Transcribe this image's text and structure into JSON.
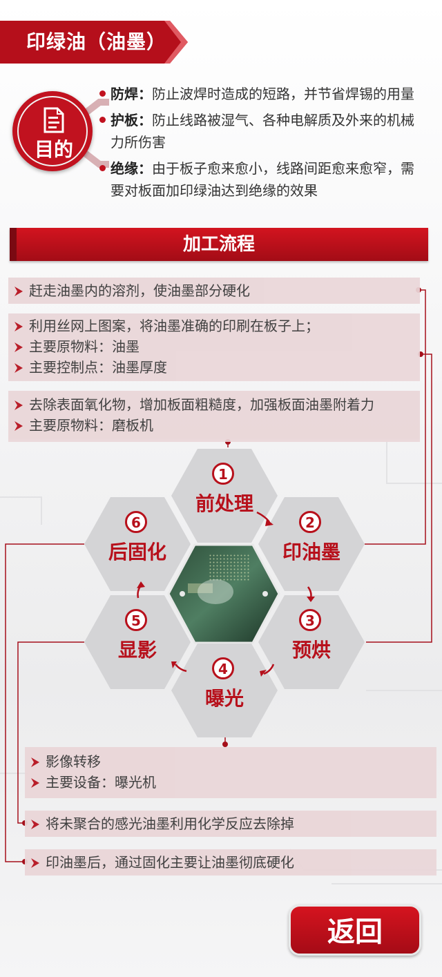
{
  "header": {
    "title": "印绿油（油墨）"
  },
  "purpose": {
    "badge_label": "目的",
    "items": [
      {
        "term": "防焊：",
        "text": "防止波焊时造成的短路，并节省焊锡的用量"
      },
      {
        "term": "护板：",
        "text": "防止线路被湿气、各种电解质及外来的机械力所伤害"
      },
      {
        "term": "绝缘：",
        "text": "由于板子愈来愈小，线路间距愈来愈窄，需要对板面加印绿油达到绝缘的效果"
      }
    ]
  },
  "process": {
    "section_title": "加工流程",
    "boxes": {
      "cure": [
        "赶走油墨内的溶剂，使油墨部分硬化"
      ],
      "print": [
        "利用丝网上图案，将油墨准确的印刷在板子上；",
        "主要原物料：油墨",
        "主要控制点：油墨厚度"
      ],
      "pretreat": [
        "去除表面氧化物，增加板面粗糙度，加强板面油墨附着力",
        "主要原物料：磨板机"
      ],
      "expose": [
        "影像转移",
        "主要设备：曝光机"
      ],
      "develop": [
        "将未聚合的感光油墨利用化学反应去除掉"
      ],
      "postcure": [
        "印油墨后，通过固化主要让油墨彻底硬化"
      ]
    },
    "steps": [
      {
        "num": "1",
        "label": "前处理"
      },
      {
        "num": "2",
        "label": "印油墨"
      },
      {
        "num": "3",
        "label": "预烘"
      },
      {
        "num": "4",
        "label": "曝光"
      },
      {
        "num": "5",
        "label": "显影"
      },
      {
        "num": "6",
        "label": "后固化"
      }
    ]
  },
  "back_button": {
    "label": "返回"
  },
  "colors": {
    "accent": "#c1121f",
    "hex_fill": "#d4d4d6",
    "box_fill": "#ead6d8"
  }
}
